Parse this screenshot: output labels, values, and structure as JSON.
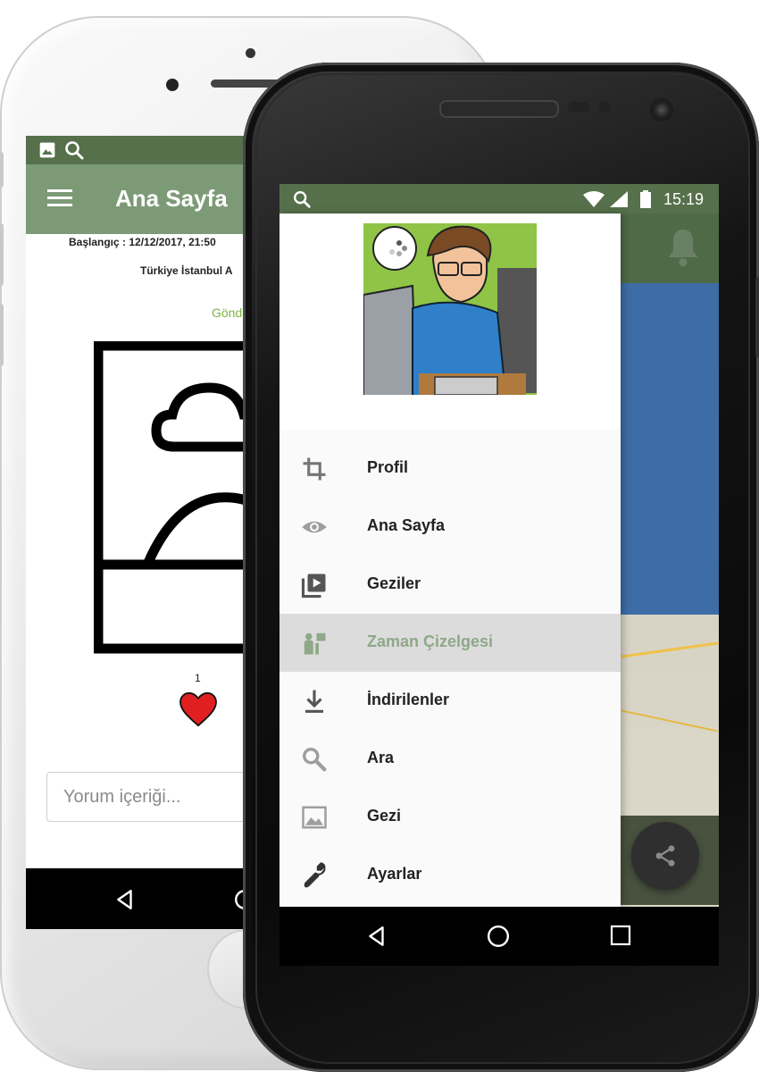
{
  "back_phone": {
    "toolbar_title": "Ana Sayfa",
    "start_line": "Başlangıç : 12/12/2017, 21:50",
    "location_line": "Türkiye İstanbul A",
    "send_status": "Gönd",
    "like_count": "1",
    "comment_placeholder": "Yorum içeriği...",
    "status_icons": [
      "image-icon",
      "search-icon"
    ]
  },
  "front_phone": {
    "status_time": "15:19",
    "drawer_menu": [
      {
        "label": "Profil",
        "icon": "crop-icon"
      },
      {
        "label": "Ana Sayfa",
        "icon": "eye-icon"
      },
      {
        "label": "Geziler",
        "icon": "video-library-icon"
      },
      {
        "label": "Zaman Çizelgesi",
        "icon": "timeline-icon",
        "active": true
      },
      {
        "label": "İndirilenler",
        "icon": "download-icon"
      },
      {
        "label": "Ara",
        "icon": "search-icon"
      },
      {
        "label": "Gezi",
        "icon": "image-icon"
      },
      {
        "label": "Ayarlar",
        "icon": "wrench-icon"
      }
    ]
  },
  "colors": {
    "status_bar": "#55704b",
    "toolbar": "#7c9a76",
    "active_item_text": "#8fa888",
    "active_item_bg": "#dcdcdc",
    "heart": "#e02020"
  }
}
